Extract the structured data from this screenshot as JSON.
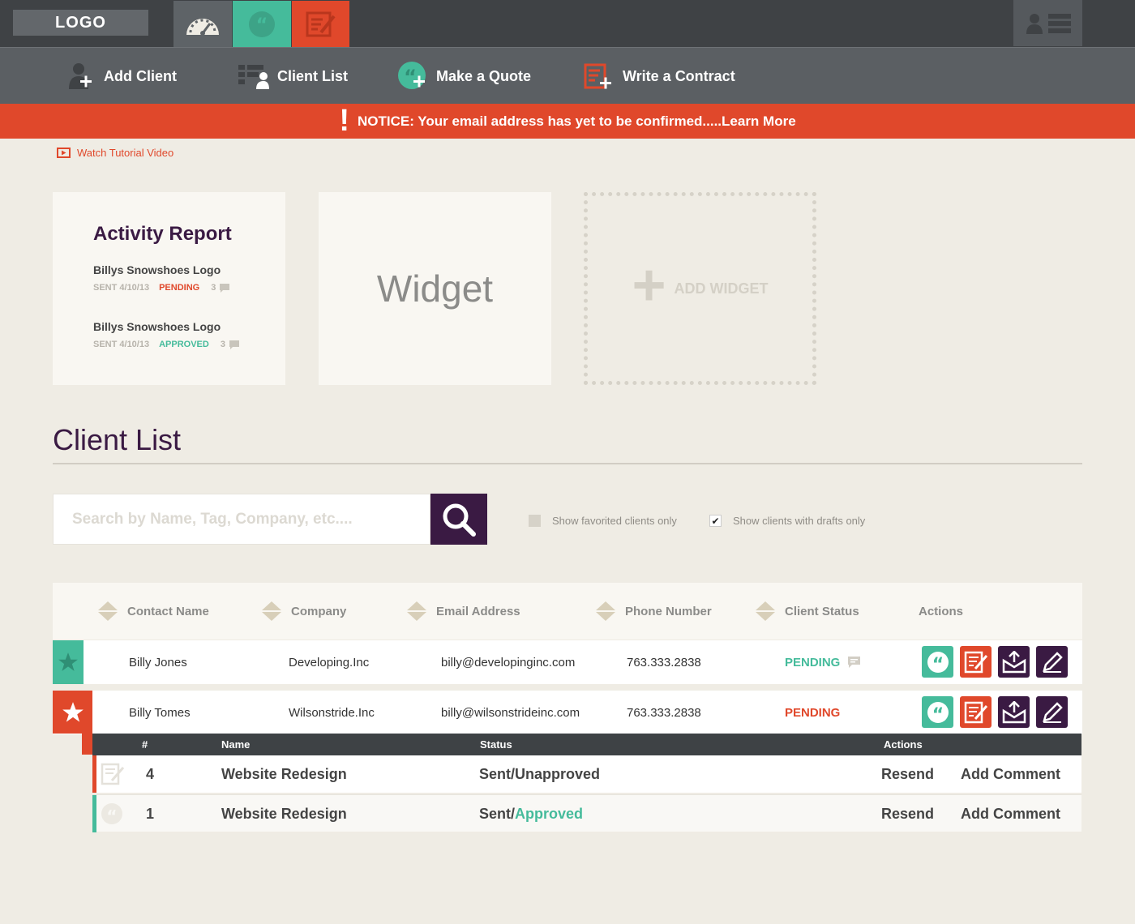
{
  "top": {
    "logo": "LOGO",
    "tabs": [
      {
        "icon": "dashboard-gauge-icon"
      },
      {
        "icon": "quote-icon"
      },
      {
        "icon": "contract-icon"
      }
    ],
    "user_icons": [
      "user-icon",
      "list-icon"
    ]
  },
  "actions": [
    {
      "label": "Add Client",
      "icon": "add-client-icon"
    },
    {
      "label": "Client List",
      "icon": "client-list-icon"
    },
    {
      "label": "Make a Quote",
      "icon": "make-quote-icon"
    },
    {
      "label": "Write a Contract",
      "icon": "write-contract-icon"
    }
  ],
  "notice": {
    "text": "NOTICE: Your email address has yet to be confirmed.....Learn More"
  },
  "tutorial": {
    "label": "Watch Tutorial Video"
  },
  "activity": {
    "title": "Activity Report",
    "items": [
      {
        "name": "Billys Snowshoes Logo",
        "sent": "SENT 4/10/13",
        "status": "PENDING",
        "comments": "3"
      },
      {
        "name": "Billys Snowshoes Logo",
        "sent": "SENT 4/10/13",
        "status": "APPROVED",
        "comments": "3"
      }
    ]
  },
  "widget": {
    "label": "Widget"
  },
  "add_widget": {
    "label": "ADD WIDGET"
  },
  "client_list": {
    "title": "Client List",
    "search_placeholder": "Search by Name, Tag, Company, etc....",
    "filters": [
      {
        "label": "Show favorited clients only",
        "checked": false
      },
      {
        "label": "Show clients with drafts only",
        "checked": true
      }
    ],
    "columns": [
      "Contact Name",
      "Company",
      "Email Address",
      "Phone Number",
      "Client Status",
      "Actions"
    ],
    "rows": [
      {
        "name": "Billy Jones",
        "company": "Developing.Inc",
        "email": "billy@developinginc.com",
        "phone": "763.333.2838",
        "status": "PENDING",
        "status_color": "#45bb9b"
      },
      {
        "name": "Billy Tomes",
        "company": "Wilsonstride.Inc",
        "email": "billy@wilsonstrideinc.com",
        "phone": "763.333.2838",
        "status": "PENDING",
        "status_color": "#e0482b"
      }
    ],
    "sub": {
      "columns": {
        "num": "#",
        "name": "Name",
        "status": "Status",
        "actions": "Actions"
      },
      "rows": [
        {
          "num": "4",
          "name": "Website Redesign",
          "status_prefix": "Sent/Unapproved",
          "status_suffix": "",
          "resend": "Resend",
          "comment": "Add Comment"
        },
        {
          "num": "1",
          "name": "Website Redesign",
          "status_prefix": "Sent/",
          "status_suffix": "Approved",
          "resend": "Resend",
          "comment": "Add Comment"
        }
      ]
    }
  },
  "colors": {
    "accent_red": "#e0482b",
    "accent_green": "#45bb9b",
    "purple": "#3a1a43"
  }
}
